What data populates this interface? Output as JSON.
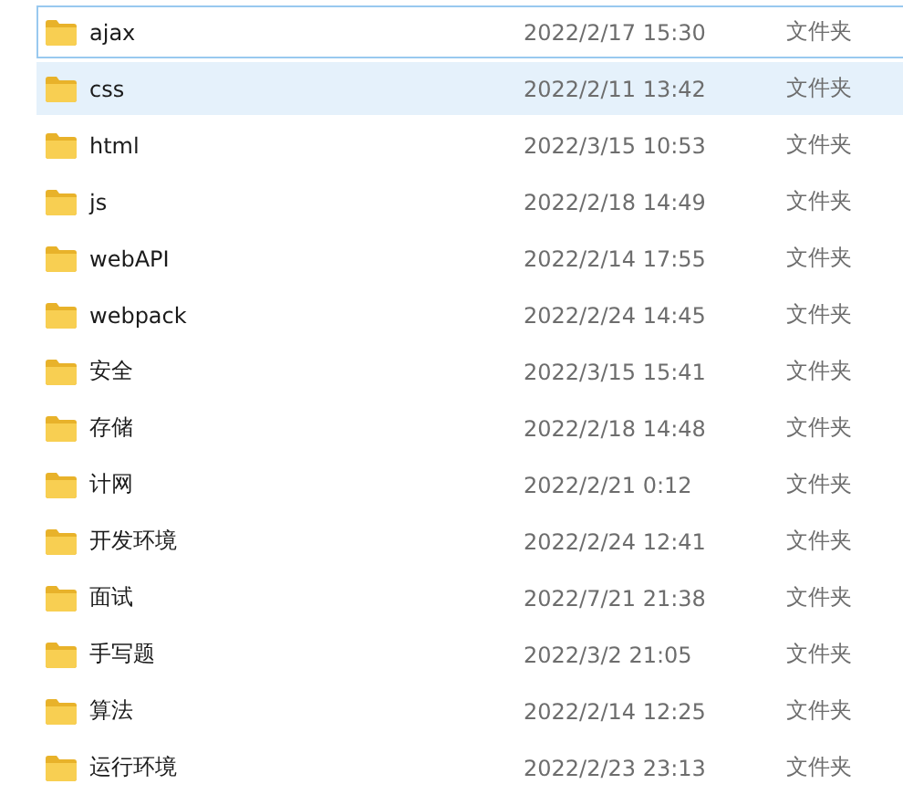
{
  "files": [
    {
      "name": "ajax",
      "modified": "2022/2/17 15:30",
      "type": "文件夹",
      "focused": true,
      "hovered": false
    },
    {
      "name": "css",
      "modified": "2022/2/11 13:42",
      "type": "文件夹",
      "focused": false,
      "hovered": true
    },
    {
      "name": "html",
      "modified": "2022/3/15 10:53",
      "type": "文件夹",
      "focused": false,
      "hovered": false
    },
    {
      "name": "js",
      "modified": "2022/2/18 14:49",
      "type": "文件夹",
      "focused": false,
      "hovered": false
    },
    {
      "name": "webAPI",
      "modified": "2022/2/14 17:55",
      "type": "文件夹",
      "focused": false,
      "hovered": false
    },
    {
      "name": "webpack",
      "modified": "2022/2/24 14:45",
      "type": "文件夹",
      "focused": false,
      "hovered": false
    },
    {
      "name": "安全",
      "modified": "2022/3/15 15:41",
      "type": "文件夹",
      "focused": false,
      "hovered": false
    },
    {
      "name": "存储",
      "modified": "2022/2/18 14:48",
      "type": "文件夹",
      "focused": false,
      "hovered": false
    },
    {
      "name": "计网",
      "modified": "2022/2/21 0:12",
      "type": "文件夹",
      "focused": false,
      "hovered": false
    },
    {
      "name": "开发环境",
      "modified": "2022/2/24 12:41",
      "type": "文件夹",
      "focused": false,
      "hovered": false
    },
    {
      "name": "面试",
      "modified": "2022/7/21 21:38",
      "type": "文件夹",
      "focused": false,
      "hovered": false
    },
    {
      "name": "手写题",
      "modified": "2022/3/2 21:05",
      "type": "文件夹",
      "focused": false,
      "hovered": false
    },
    {
      "name": "算法",
      "modified": "2022/2/14 12:25",
      "type": "文件夹",
      "focused": false,
      "hovered": false
    },
    {
      "name": "运行环境",
      "modified": "2022/2/23 23:13",
      "type": "文件夹",
      "focused": false,
      "hovered": false
    }
  ]
}
